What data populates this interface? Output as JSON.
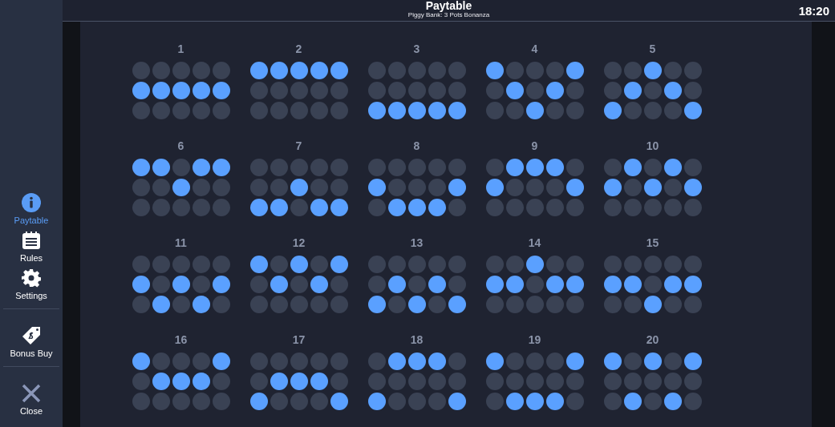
{
  "sidebar": {
    "items": [
      {
        "kind": "info",
        "label": "Paytable",
        "selected": true
      },
      {
        "kind": "rules",
        "label": "Rules",
        "selected": false
      },
      {
        "kind": "settings",
        "label": "Settings",
        "selected": false
      },
      {
        "kind": "bonus",
        "label": "Bonus Buy",
        "selected": false
      },
      {
        "kind": "close",
        "label": "Close",
        "selected": false
      }
    ]
  },
  "header": {
    "title": "Paytable",
    "subtitle": "Piggy Bank: 3 Pots Bonanza",
    "time": "18:20"
  },
  "paylines": [
    {
      "number": "1",
      "rows": [
        [
          false,
          false,
          false,
          false,
          false
        ],
        [
          true,
          true,
          true,
          true,
          true
        ],
        [
          false,
          false,
          false,
          false,
          false
        ]
      ]
    },
    {
      "number": "2",
      "rows": [
        [
          true,
          true,
          true,
          true,
          true
        ],
        [
          false,
          false,
          false,
          false,
          false
        ],
        [
          false,
          false,
          false,
          false,
          false
        ]
      ]
    },
    {
      "number": "3",
      "rows": [
        [
          false,
          false,
          false,
          false,
          false
        ],
        [
          false,
          false,
          false,
          false,
          false
        ],
        [
          true,
          true,
          true,
          true,
          true
        ]
      ]
    },
    {
      "number": "4",
      "rows": [
        [
          true,
          false,
          false,
          false,
          true
        ],
        [
          false,
          true,
          false,
          true,
          false
        ],
        [
          false,
          false,
          true,
          false,
          false
        ]
      ]
    },
    {
      "number": "5",
      "rows": [
        [
          false,
          false,
          true,
          false,
          false
        ],
        [
          false,
          true,
          false,
          true,
          false
        ],
        [
          true,
          false,
          false,
          false,
          true
        ]
      ]
    },
    {
      "number": "6",
      "rows": [
        [
          true,
          true,
          false,
          true,
          true
        ],
        [
          false,
          false,
          true,
          false,
          false
        ],
        [
          false,
          false,
          false,
          false,
          false
        ]
      ]
    },
    {
      "number": "7",
      "rows": [
        [
          false,
          false,
          false,
          false,
          false
        ],
        [
          false,
          false,
          true,
          false,
          false
        ],
        [
          true,
          true,
          false,
          true,
          true
        ]
      ]
    },
    {
      "number": "8",
      "rows": [
        [
          false,
          false,
          false,
          false,
          false
        ],
        [
          true,
          false,
          false,
          false,
          true
        ],
        [
          false,
          true,
          true,
          true,
          false
        ]
      ]
    },
    {
      "number": "9",
      "rows": [
        [
          false,
          true,
          true,
          true,
          false
        ],
        [
          true,
          false,
          false,
          false,
          true
        ],
        [
          false,
          false,
          false,
          false,
          false
        ]
      ]
    },
    {
      "number": "10",
      "rows": [
        [
          false,
          true,
          false,
          true,
          false
        ],
        [
          true,
          false,
          true,
          false,
          true
        ],
        [
          false,
          false,
          false,
          false,
          false
        ]
      ]
    },
    {
      "number": "11",
      "rows": [
        [
          false,
          false,
          false,
          false,
          false
        ],
        [
          true,
          false,
          true,
          false,
          true
        ],
        [
          false,
          true,
          false,
          true,
          false
        ]
      ]
    },
    {
      "number": "12",
      "rows": [
        [
          true,
          false,
          true,
          false,
          true
        ],
        [
          false,
          true,
          false,
          true,
          false
        ],
        [
          false,
          false,
          false,
          false,
          false
        ]
      ]
    },
    {
      "number": "13",
      "rows": [
        [
          false,
          false,
          false,
          false,
          false
        ],
        [
          false,
          true,
          false,
          true,
          false
        ],
        [
          true,
          false,
          true,
          false,
          true
        ]
      ]
    },
    {
      "number": "14",
      "rows": [
        [
          false,
          false,
          true,
          false,
          false
        ],
        [
          true,
          true,
          false,
          true,
          true
        ],
        [
          false,
          false,
          false,
          false,
          false
        ]
      ]
    },
    {
      "number": "15",
      "rows": [
        [
          false,
          false,
          false,
          false,
          false
        ],
        [
          true,
          true,
          false,
          true,
          true
        ],
        [
          false,
          false,
          true,
          false,
          false
        ]
      ]
    },
    {
      "number": "16",
      "rows": [
        [
          true,
          false,
          false,
          false,
          true
        ],
        [
          false,
          true,
          true,
          true,
          false
        ],
        [
          false,
          false,
          false,
          false,
          false
        ]
      ]
    },
    {
      "number": "17",
      "rows": [
        [
          false,
          false,
          false,
          false,
          false
        ],
        [
          false,
          true,
          true,
          true,
          false
        ],
        [
          true,
          false,
          false,
          false,
          true
        ]
      ]
    },
    {
      "number": "18",
      "rows": [
        [
          false,
          true,
          true,
          true,
          false
        ],
        [
          false,
          false,
          false,
          false,
          false
        ],
        [
          true,
          false,
          false,
          false,
          true
        ]
      ]
    },
    {
      "number": "19",
      "rows": [
        [
          true,
          false,
          false,
          false,
          true
        ],
        [
          false,
          false,
          false,
          false,
          false
        ],
        [
          false,
          true,
          true,
          true,
          false
        ]
      ]
    },
    {
      "number": "20",
      "rows": [
        [
          true,
          false,
          true,
          false,
          true
        ],
        [
          false,
          false,
          false,
          false,
          false
        ],
        [
          false,
          true,
          false,
          true,
          false
        ]
      ]
    }
  ]
}
